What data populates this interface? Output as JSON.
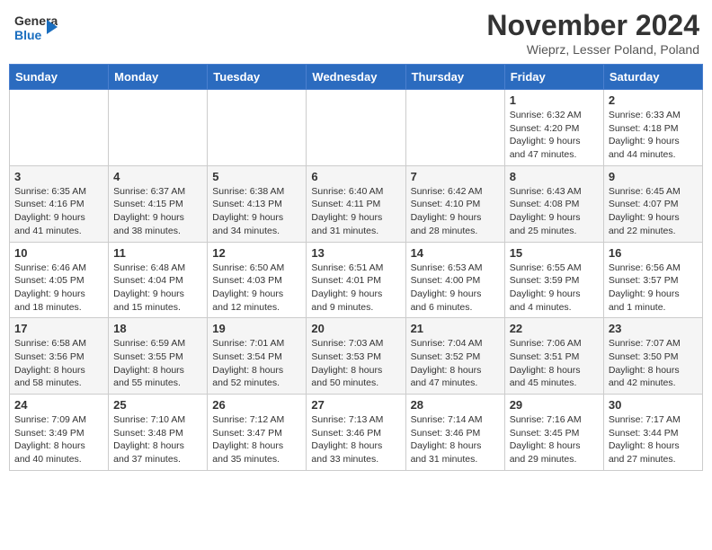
{
  "header": {
    "logo_line1": "General",
    "logo_line2": "Blue",
    "month_title": "November 2024",
    "location": "Wieprz, Lesser Poland, Poland"
  },
  "weekdays": [
    "Sunday",
    "Monday",
    "Tuesday",
    "Wednesday",
    "Thursday",
    "Friday",
    "Saturday"
  ],
  "weeks": [
    [
      {
        "day": "",
        "info": ""
      },
      {
        "day": "",
        "info": ""
      },
      {
        "day": "",
        "info": ""
      },
      {
        "day": "",
        "info": ""
      },
      {
        "day": "",
        "info": ""
      },
      {
        "day": "1",
        "info": "Sunrise: 6:32 AM\nSunset: 4:20 PM\nDaylight: 9 hours and 47 minutes."
      },
      {
        "day": "2",
        "info": "Sunrise: 6:33 AM\nSunset: 4:18 PM\nDaylight: 9 hours and 44 minutes."
      }
    ],
    [
      {
        "day": "3",
        "info": "Sunrise: 6:35 AM\nSunset: 4:16 PM\nDaylight: 9 hours and 41 minutes."
      },
      {
        "day": "4",
        "info": "Sunrise: 6:37 AM\nSunset: 4:15 PM\nDaylight: 9 hours and 38 minutes."
      },
      {
        "day": "5",
        "info": "Sunrise: 6:38 AM\nSunset: 4:13 PM\nDaylight: 9 hours and 34 minutes."
      },
      {
        "day": "6",
        "info": "Sunrise: 6:40 AM\nSunset: 4:11 PM\nDaylight: 9 hours and 31 minutes."
      },
      {
        "day": "7",
        "info": "Sunrise: 6:42 AM\nSunset: 4:10 PM\nDaylight: 9 hours and 28 minutes."
      },
      {
        "day": "8",
        "info": "Sunrise: 6:43 AM\nSunset: 4:08 PM\nDaylight: 9 hours and 25 minutes."
      },
      {
        "day": "9",
        "info": "Sunrise: 6:45 AM\nSunset: 4:07 PM\nDaylight: 9 hours and 22 minutes."
      }
    ],
    [
      {
        "day": "10",
        "info": "Sunrise: 6:46 AM\nSunset: 4:05 PM\nDaylight: 9 hours and 18 minutes."
      },
      {
        "day": "11",
        "info": "Sunrise: 6:48 AM\nSunset: 4:04 PM\nDaylight: 9 hours and 15 minutes."
      },
      {
        "day": "12",
        "info": "Sunrise: 6:50 AM\nSunset: 4:03 PM\nDaylight: 9 hours and 12 minutes."
      },
      {
        "day": "13",
        "info": "Sunrise: 6:51 AM\nSunset: 4:01 PM\nDaylight: 9 hours and 9 minutes."
      },
      {
        "day": "14",
        "info": "Sunrise: 6:53 AM\nSunset: 4:00 PM\nDaylight: 9 hours and 6 minutes."
      },
      {
        "day": "15",
        "info": "Sunrise: 6:55 AM\nSunset: 3:59 PM\nDaylight: 9 hours and 4 minutes."
      },
      {
        "day": "16",
        "info": "Sunrise: 6:56 AM\nSunset: 3:57 PM\nDaylight: 9 hours and 1 minute."
      }
    ],
    [
      {
        "day": "17",
        "info": "Sunrise: 6:58 AM\nSunset: 3:56 PM\nDaylight: 8 hours and 58 minutes."
      },
      {
        "day": "18",
        "info": "Sunrise: 6:59 AM\nSunset: 3:55 PM\nDaylight: 8 hours and 55 minutes."
      },
      {
        "day": "19",
        "info": "Sunrise: 7:01 AM\nSunset: 3:54 PM\nDaylight: 8 hours and 52 minutes."
      },
      {
        "day": "20",
        "info": "Sunrise: 7:03 AM\nSunset: 3:53 PM\nDaylight: 8 hours and 50 minutes."
      },
      {
        "day": "21",
        "info": "Sunrise: 7:04 AM\nSunset: 3:52 PM\nDaylight: 8 hours and 47 minutes."
      },
      {
        "day": "22",
        "info": "Sunrise: 7:06 AM\nSunset: 3:51 PM\nDaylight: 8 hours and 45 minutes."
      },
      {
        "day": "23",
        "info": "Sunrise: 7:07 AM\nSunset: 3:50 PM\nDaylight: 8 hours and 42 minutes."
      }
    ],
    [
      {
        "day": "24",
        "info": "Sunrise: 7:09 AM\nSunset: 3:49 PM\nDaylight: 8 hours and 40 minutes."
      },
      {
        "day": "25",
        "info": "Sunrise: 7:10 AM\nSunset: 3:48 PM\nDaylight: 8 hours and 37 minutes."
      },
      {
        "day": "26",
        "info": "Sunrise: 7:12 AM\nSunset: 3:47 PM\nDaylight: 8 hours and 35 minutes."
      },
      {
        "day": "27",
        "info": "Sunrise: 7:13 AM\nSunset: 3:46 PM\nDaylight: 8 hours and 33 minutes."
      },
      {
        "day": "28",
        "info": "Sunrise: 7:14 AM\nSunset: 3:46 PM\nDaylight: 8 hours and 31 minutes."
      },
      {
        "day": "29",
        "info": "Sunrise: 7:16 AM\nSunset: 3:45 PM\nDaylight: 8 hours and 29 minutes."
      },
      {
        "day": "30",
        "info": "Sunrise: 7:17 AM\nSunset: 3:44 PM\nDaylight: 8 hours and 27 minutes."
      }
    ]
  ]
}
